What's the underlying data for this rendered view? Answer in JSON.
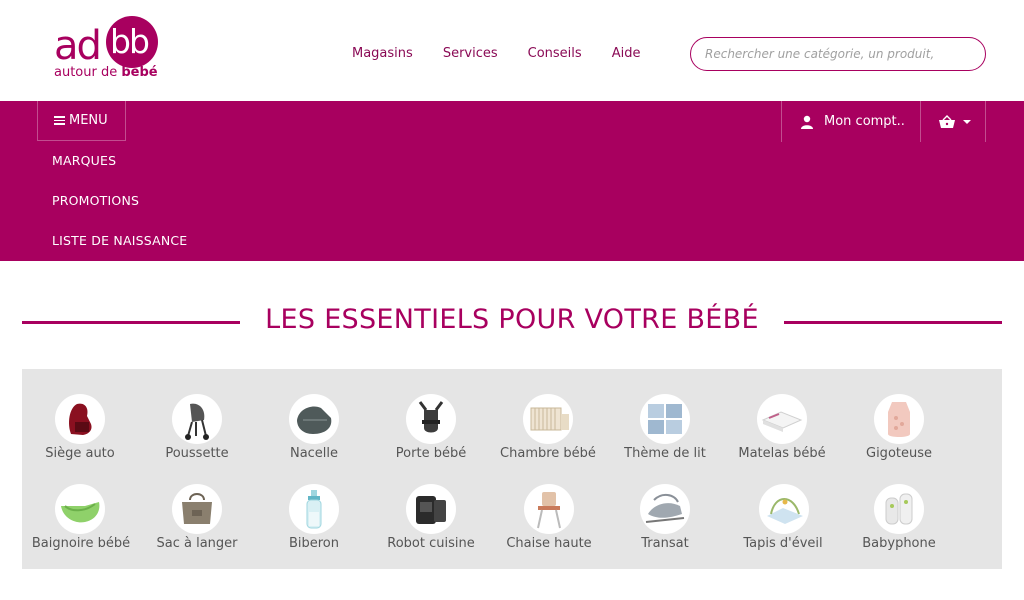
{
  "brand": {
    "logo_ad": "ad",
    "logo_bb": "bb",
    "tagline_prefix": "autour de ",
    "tagline_bold": "bébé",
    "color": "#a8005f"
  },
  "topnav": [
    "Magasins",
    "Services",
    "Conseils",
    "Aide"
  ],
  "search": {
    "placeholder": "Rechercher une catégorie, un produit,"
  },
  "band": {
    "menu_label": "MENU",
    "links": [
      "MARQUES",
      "PROMOTIONS",
      "LISTE DE NAISSANCE"
    ],
    "account_label": "Mon compt.."
  },
  "section_title": "LES ESSENTIELS POUR VOTRE BÉBÉ",
  "categories": [
    {
      "label": "Siège auto",
      "icon": "car-seat-icon"
    },
    {
      "label": "Poussette",
      "icon": "stroller-icon"
    },
    {
      "label": "Nacelle",
      "icon": "bassinet-icon"
    },
    {
      "label": "Porte bébé",
      "icon": "baby-carrier-icon"
    },
    {
      "label": "Chambre bébé",
      "icon": "crib-icon"
    },
    {
      "label": "Thème de lit",
      "icon": "bed-linen-icon"
    },
    {
      "label": "Matelas bébé",
      "icon": "mattress-icon"
    },
    {
      "label": "Gigoteuse",
      "icon": "sleeping-bag-icon"
    },
    {
      "label": "Baignoire bébé",
      "icon": "baby-bath-icon"
    },
    {
      "label": "Sac à langer",
      "icon": "diaper-bag-icon"
    },
    {
      "label": "Biberon",
      "icon": "bottle-icon"
    },
    {
      "label": "Robot cuisine",
      "icon": "food-processor-icon"
    },
    {
      "label": "Chaise haute",
      "icon": "high-chair-icon"
    },
    {
      "label": "Transat",
      "icon": "bouncer-icon"
    },
    {
      "label": "Tapis d'éveil",
      "icon": "play-mat-icon"
    },
    {
      "label": "Babyphone",
      "icon": "baby-monitor-icon"
    }
  ]
}
